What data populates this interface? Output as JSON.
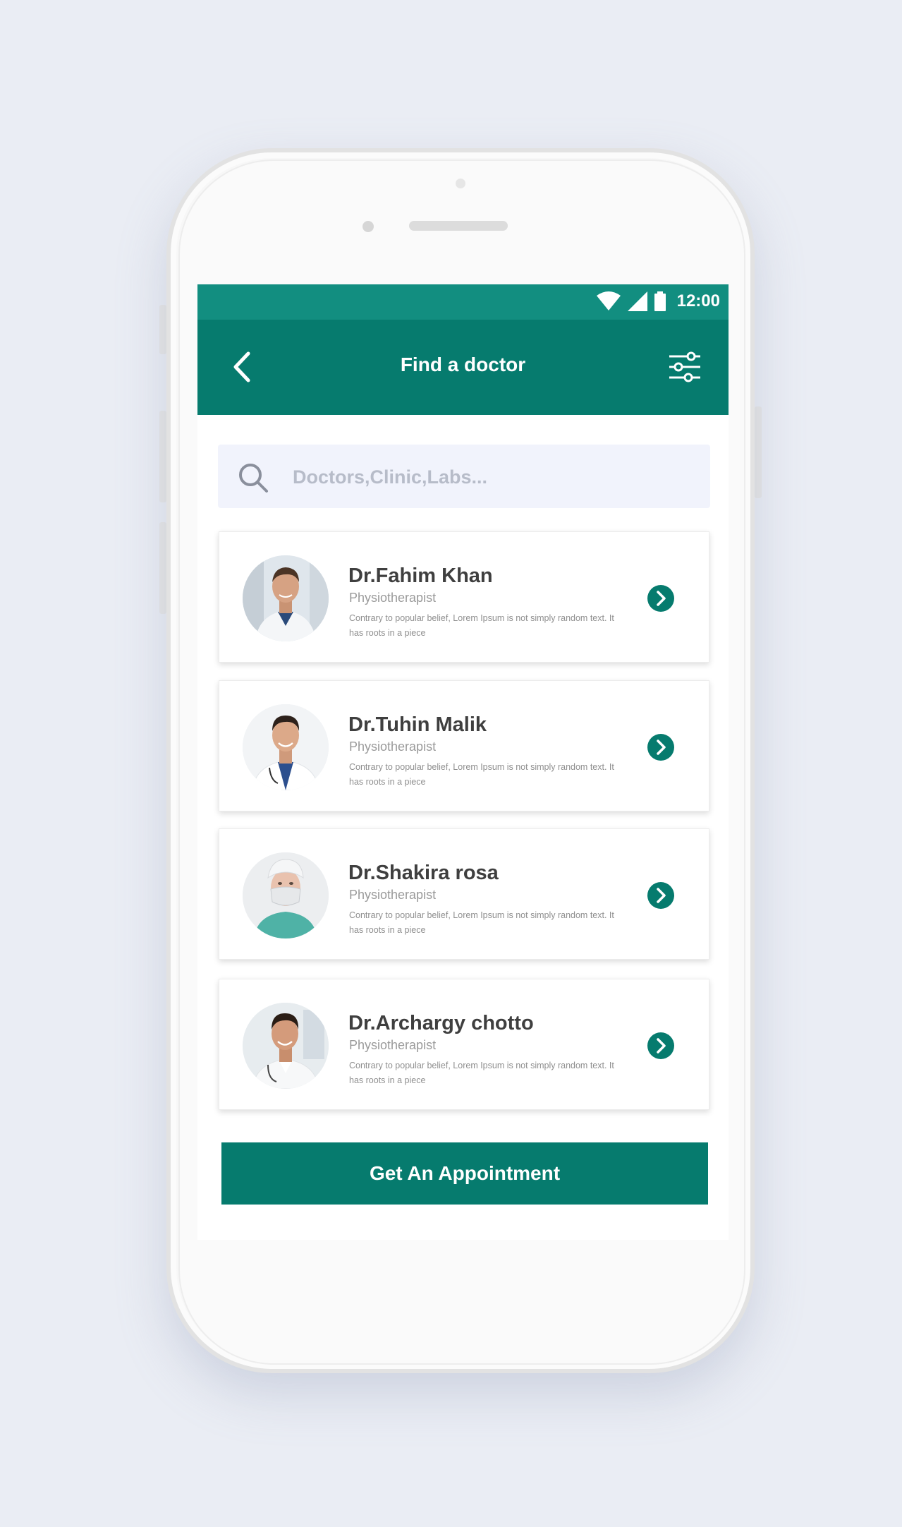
{
  "status_bar": {
    "time": "12:00",
    "icons": [
      "wifi-icon",
      "cell-signal-icon",
      "battery-icon"
    ]
  },
  "header": {
    "title": "Find a doctor",
    "back_icon": "chevron-left-icon",
    "filter_icon": "sliders-icon"
  },
  "search": {
    "placeholder": "Doctors,Clinic,Labs...",
    "value": "",
    "icon": "search-icon"
  },
  "doctors": [
    {
      "name": "Dr.Fahim Khan",
      "specialty": "Physiotherapist",
      "description": "Contrary to popular belief, Lorem Ipsum is not simply random text. It has roots in a piece"
    },
    {
      "name": "Dr.Tuhin Malik",
      "specialty": "Physiotherapist",
      "description": "Contrary to popular belief, Lorem Ipsum is not simply random text. It has roots in a piece"
    },
    {
      "name": "Dr.Shakira rosa",
      "specialty": "Physiotherapist",
      "description": "Contrary to popular belief, Lorem Ipsum is not simply random text. It has roots in a piece"
    },
    {
      "name": "Dr.Archargy chotto",
      "specialty": "Physiotherapist",
      "description": "Contrary to popular belief, Lorem Ipsum is not simply random text. It has roots in a piece"
    }
  ],
  "cta": {
    "label": "Get An Appointment"
  },
  "colors": {
    "primary": "#067b6e",
    "status_bar": "#128e80",
    "background": "#eaedf4",
    "search_bg": "#f1f3fc"
  }
}
